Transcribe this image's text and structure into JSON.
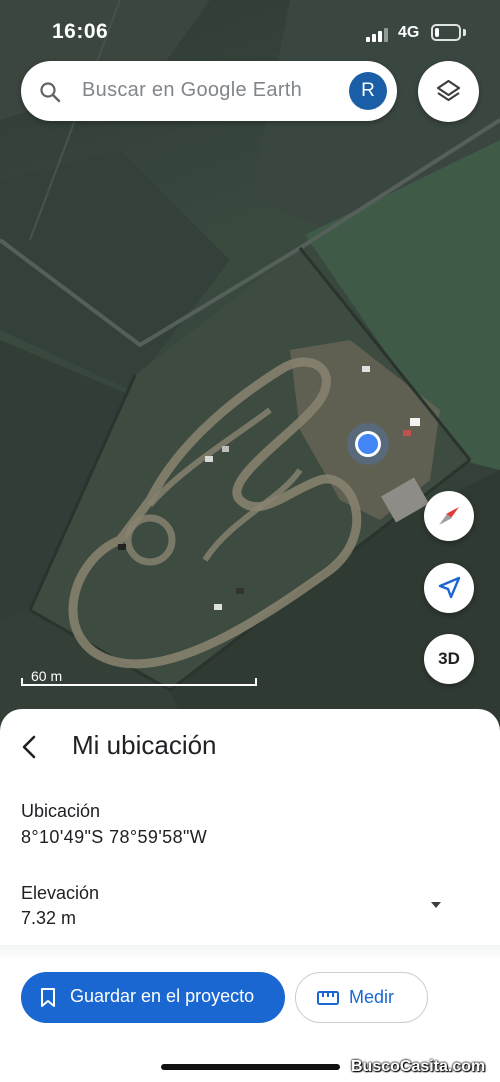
{
  "status_bar": {
    "time": "16:06",
    "network": "4G",
    "battery_level": 0.2
  },
  "search": {
    "placeholder": "Buscar en Google Earth",
    "avatar_initial": "R",
    "icon": "search-icon"
  },
  "map": {
    "scale_label": "60 m",
    "three_d_label": "3D",
    "controls": [
      "layers-icon",
      "compass-icon",
      "locate-icon"
    ]
  },
  "sheet": {
    "title": "Mi ubicación",
    "location_label": "Ubicación",
    "location_value": "8°10'49\"S 78°59'58\"W",
    "elevation_label": "Elevación",
    "elevation_value": "7.32 m",
    "save_label": "Guardar en el proyecto",
    "measure_label": "Medir"
  },
  "watermark": "BuscoCasita.com",
  "colors": {
    "accent": "#1a67d2",
    "avatar": "#1a5ea8",
    "location_dot": "#4285f4",
    "compass_red": "#e53935"
  }
}
